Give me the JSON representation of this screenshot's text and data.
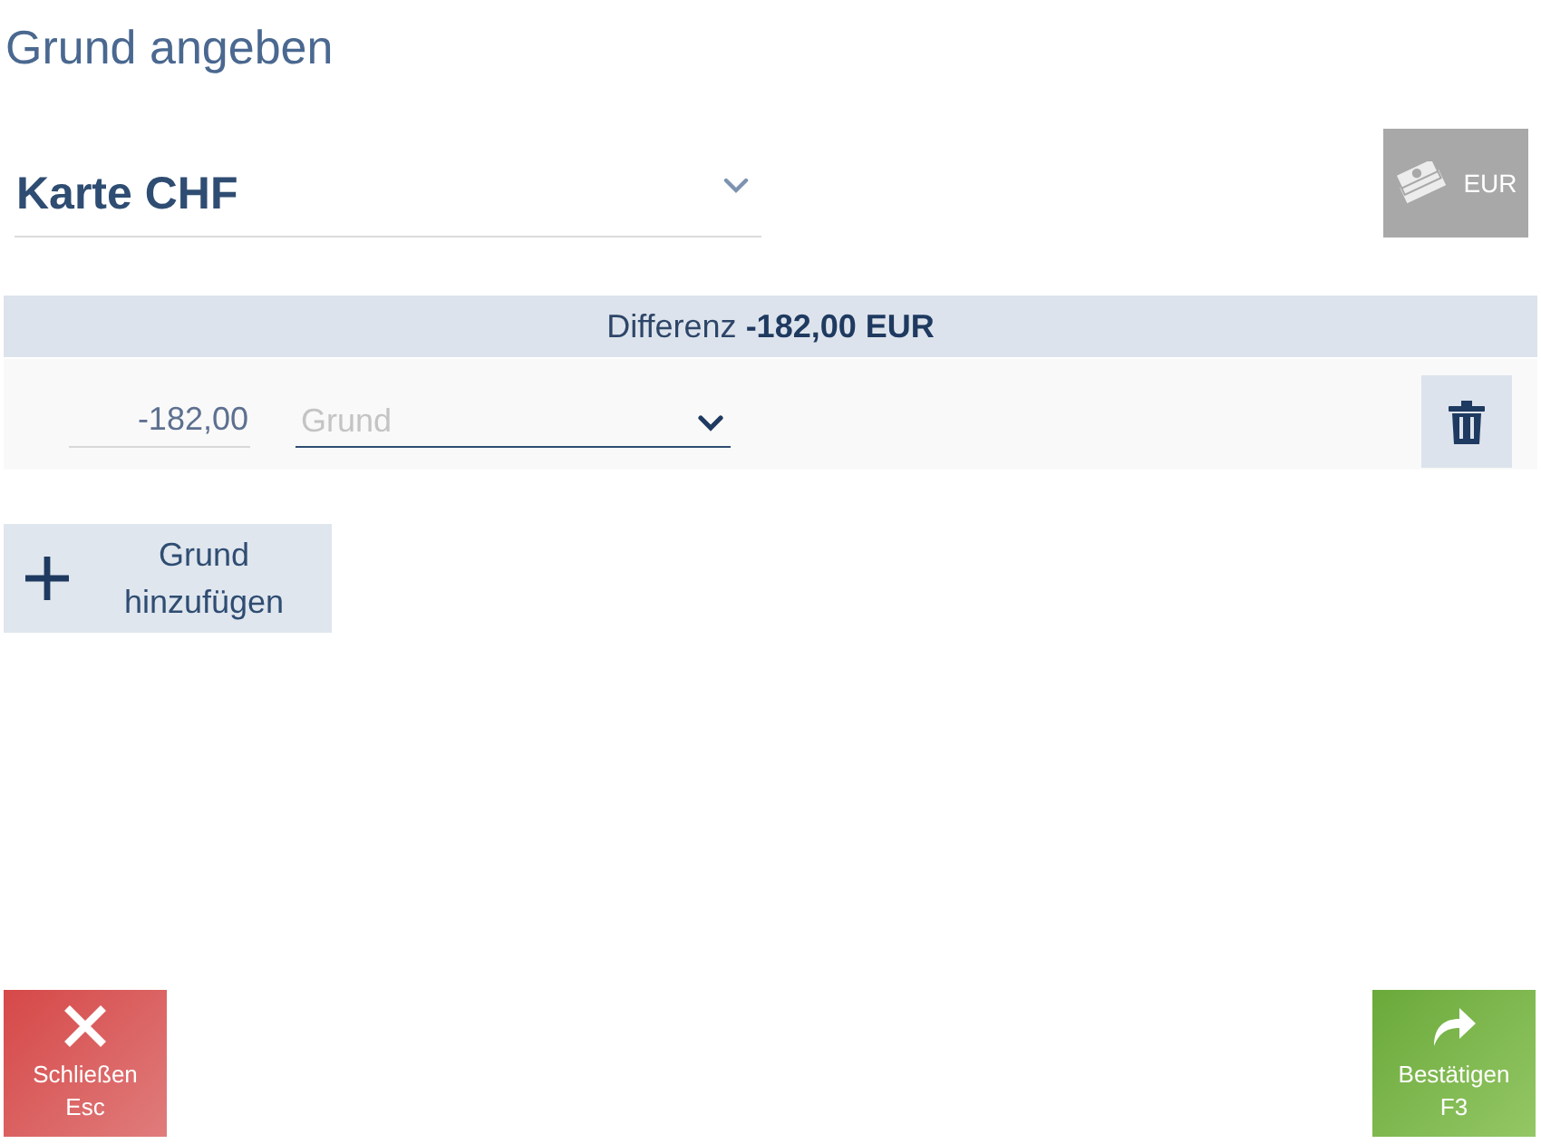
{
  "title": "Grund angeben",
  "payment_select": {
    "value": "Karte CHF"
  },
  "currency_button": {
    "label": "EUR",
    "disabled": true
  },
  "difference": {
    "text": "Differenz **-182,00 EUR**"
  },
  "reasons": [
    {
      "amount": "-182,00",
      "reason_placeholder": "Grund"
    }
  ],
  "add_button": {
    "label": "Grund hinzufügen"
  },
  "footer_buttons": [
    {
      "kind": "close",
      "label": "Schließen",
      "shortcut": "Esc"
    },
    {
      "kind": "confirm",
      "label": "Bestätigen",
      "shortcut": "F3"
    }
  ]
}
